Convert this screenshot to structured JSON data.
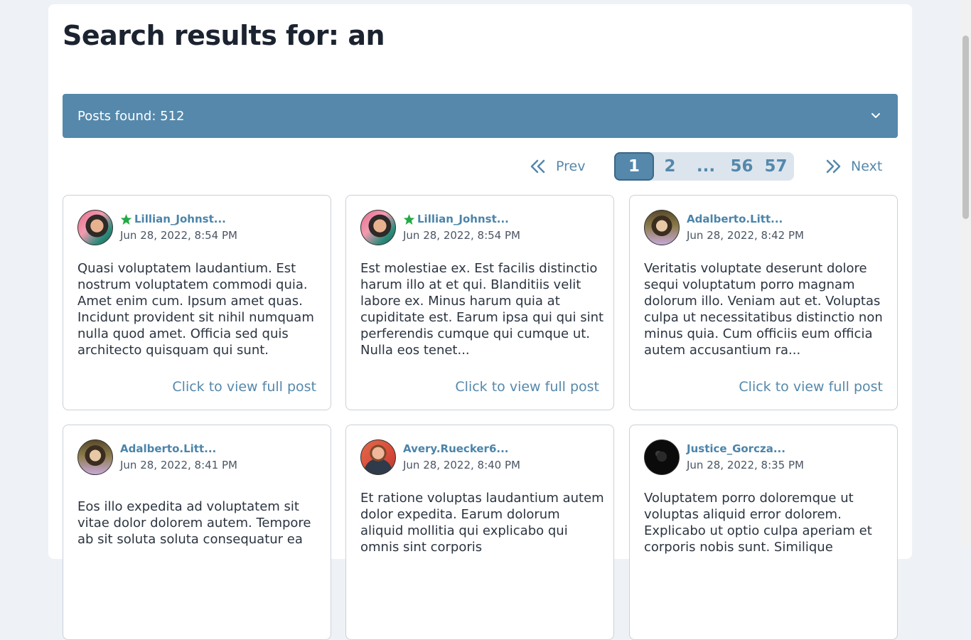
{
  "page_title": "Search results for: an",
  "posts_found": "Posts found: 512",
  "pagination": {
    "prev": "Prev",
    "next": "Next",
    "pages": [
      "1",
      "2",
      "...",
      "56",
      "57"
    ],
    "active_page": "1"
  },
  "link_label": "Click to view full post",
  "posts": [
    {
      "author": "Lillian_Johnst...",
      "starred": true,
      "date": "Jun 28, 2022, 8:54 PM",
      "body": "Quasi voluptatem laudantium. Est nostrum voluptatem commodi quia. Amet enim cum. Ipsum amet quas. Incidunt provident sit nihil numquam nulla quod amet. Officia sed quis architecto quisquam qui sunt."
    },
    {
      "author": "Lillian_Johnst...",
      "starred": true,
      "date": "Jun 28, 2022, 8:54 PM",
      "body": "Est molestiae ex. Est facilis distinctio harum illo at et qui. Blanditiis velit labore ex. Minus harum quia at cupiditate est. Earum ipsa qui qui sint perferendis cumque qui cumque ut. Nulla eos tenet..."
    },
    {
      "author": "Adalberto.Litt...",
      "starred": false,
      "date": "Jun 28, 2022, 8:42 PM",
      "body": "Veritatis voluptate deserunt dolore sequi voluptatum porro magnam dolorum illo. Veniam aut et. Voluptas culpa ut necessitatibus distinctio non minus quia. Cum officiis eum officia autem accusantium ra..."
    },
    {
      "author": "Adalberto.Litt...",
      "starred": false,
      "date": "Jun 28, 2022, 8:41 PM",
      "body": "Eos illo expedita ad voluptatem sit vitae dolor dolorem autem. Tempore ab sit soluta soluta consequatur ea"
    },
    {
      "author": "Avery.Ruecker6...",
      "starred": false,
      "date": "Jun 28, 2022, 8:40 PM",
      "body": "Et ratione voluptas laudantium autem dolor expedita. Earum dolorum aliquid mollitia qui explicabo qui omnis sint corporis"
    },
    {
      "author": "Justice_Gorcza...",
      "starred": false,
      "date": "Jun 28, 2022, 8:35 PM",
      "body": "Voluptatem porro doloremque ut voluptas aliquid error dolorem. Explicabo ut optio culpa aperiam et corporis nobis sunt. Similique"
    }
  ],
  "colors": {
    "accent": "#5588ab",
    "star": "#22aa44",
    "background": "#eef2f6"
  }
}
